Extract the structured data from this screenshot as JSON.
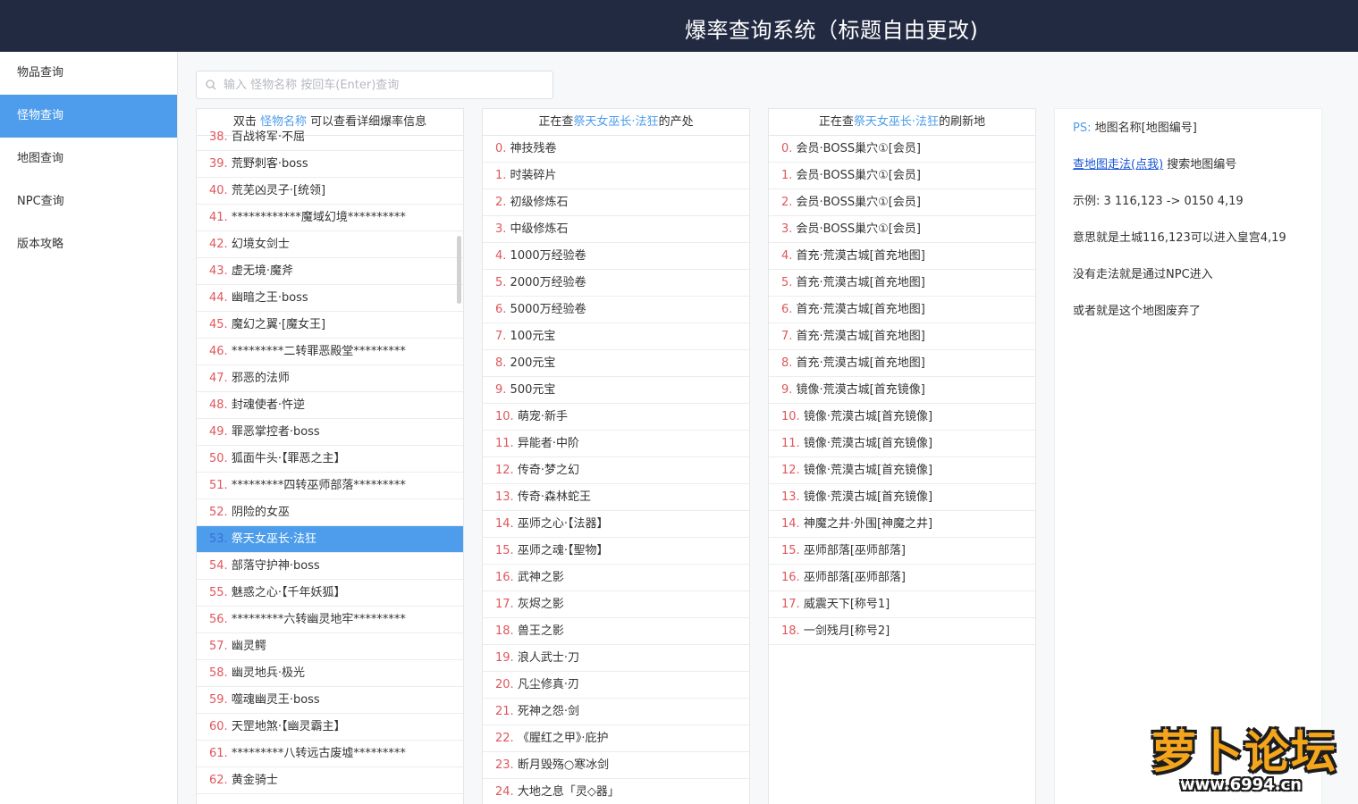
{
  "header": {
    "title": "爆率查询系统（标题自由更改)"
  },
  "sidebar": {
    "items": [
      {
        "label": "物品查询",
        "active": false
      },
      {
        "label": "怪物查询",
        "active": true
      },
      {
        "label": "地图查询",
        "active": false
      },
      {
        "label": "NPC查询",
        "active": false
      },
      {
        "label": "版本攻略",
        "active": false
      }
    ]
  },
  "search": {
    "placeholder": "输入 怪物名称 按回车(Enter)查询",
    "value": ""
  },
  "monster_list": {
    "head_prefix": "双击 ",
    "head_highlight": "怪物名称",
    "head_suffix": " 可以查看详细爆率信息",
    "selected_index": 15,
    "rows": [
      {
        "idx": "38",
        "name": "百战将军·不屈"
      },
      {
        "idx": "39",
        "name": "荒野刺客·boss"
      },
      {
        "idx": "40",
        "name": "荒芜凶灵子·[统领]"
      },
      {
        "idx": "41",
        "name": "************魔域幻境**********"
      },
      {
        "idx": "42",
        "name": "幻境女剑士"
      },
      {
        "idx": "43",
        "name": "虚无境·魔斧"
      },
      {
        "idx": "44",
        "name": "幽暗之王·boss"
      },
      {
        "idx": "45",
        "name": "魔幻之翼·[魔女王]"
      },
      {
        "idx": "46",
        "name": "*********二转罪恶殿堂*********"
      },
      {
        "idx": "47",
        "name": "邪恶的法师"
      },
      {
        "idx": "48",
        "name": "封魂使者·忤逆"
      },
      {
        "idx": "49",
        "name": "罪恶掌控者·boss"
      },
      {
        "idx": "50",
        "name": "狐面牛头·【罪恶之主】"
      },
      {
        "idx": "51",
        "name": "*********四转巫师部落*********"
      },
      {
        "idx": "52",
        "name": "阴险的女巫"
      },
      {
        "idx": "53",
        "name": "祭天女巫长·法狂"
      },
      {
        "idx": "54",
        "name": "部落守护神·boss"
      },
      {
        "idx": "55",
        "name": "魅惑之心·【千年妖狐】"
      },
      {
        "idx": "56",
        "name": "*********六转幽灵地牢*********"
      },
      {
        "idx": "57",
        "name": "幽灵鳄"
      },
      {
        "idx": "58",
        "name": "幽灵地兵·极光"
      },
      {
        "idx": "59",
        "name": "噬魂幽灵王·boss"
      },
      {
        "idx": "60",
        "name": "天罡地煞·【幽灵霸主】"
      },
      {
        "idx": "61",
        "name": "*********八转远古废墟*********"
      },
      {
        "idx": "62",
        "name": "黄金骑士"
      }
    ]
  },
  "drops": {
    "head_prefix": "正在查",
    "head_highlight": "祭天女巫长·法狂",
    "head_suffix": "的产处",
    "rows": [
      {
        "idx": "0",
        "name": "神技残卷"
      },
      {
        "idx": "1",
        "name": "时装碎片"
      },
      {
        "idx": "2",
        "name": "初级修炼石"
      },
      {
        "idx": "3",
        "name": "中级修炼石"
      },
      {
        "idx": "4",
        "name": "1000万经验卷"
      },
      {
        "idx": "5",
        "name": "2000万经验卷"
      },
      {
        "idx": "6",
        "name": "5000万经验卷"
      },
      {
        "idx": "7",
        "name": "100元宝"
      },
      {
        "idx": "8",
        "name": "200元宝"
      },
      {
        "idx": "9",
        "name": "500元宝"
      },
      {
        "idx": "10",
        "name": "萌宠·新手"
      },
      {
        "idx": "11",
        "name": "异能者·中阶"
      },
      {
        "idx": "12",
        "name": "传奇·梦之幻"
      },
      {
        "idx": "13",
        "name": "传奇·森林蛇王"
      },
      {
        "idx": "14",
        "name": "巫师之心·【法器】"
      },
      {
        "idx": "15",
        "name": "巫师之魂·【聖物】"
      },
      {
        "idx": "16",
        "name": "武神之影"
      },
      {
        "idx": "17",
        "name": "灰烬之影"
      },
      {
        "idx": "18",
        "name": "兽王之影"
      },
      {
        "idx": "19",
        "name": "浪人武士·刀"
      },
      {
        "idx": "20",
        "name": "凡尘修真·刃"
      },
      {
        "idx": "21",
        "name": "死神之怨·剑"
      },
      {
        "idx": "22",
        "name": "《腥红之甲》·庇护"
      },
      {
        "idx": "23",
        "name": "断月毁殇○寒冰剑"
      },
      {
        "idx": "24",
        "name": "大地之息「灵◇器」"
      }
    ]
  },
  "spawns": {
    "head_prefix": "正在查",
    "head_highlight": "祭天女巫长·法狂",
    "head_suffix": "的刷新地",
    "rows": [
      {
        "idx": "0",
        "name": "会员·BOSS巢穴①[会员]"
      },
      {
        "idx": "1",
        "name": "会员·BOSS巢穴①[会员]"
      },
      {
        "idx": "2",
        "name": "会员·BOSS巢穴①[会员]"
      },
      {
        "idx": "3",
        "name": "会员·BOSS巢穴①[会员]"
      },
      {
        "idx": "4",
        "name": "首充·荒漠古城[首充地图]"
      },
      {
        "idx": "5",
        "name": "首充·荒漠古城[首充地图]"
      },
      {
        "idx": "6",
        "name": "首充·荒漠古城[首充地图]"
      },
      {
        "idx": "7",
        "name": "首充·荒漠古城[首充地图]"
      },
      {
        "idx": "8",
        "name": "首充·荒漠古城[首充地图]"
      },
      {
        "idx": "9",
        "name": "镜像·荒漠古城[首充镜像]"
      },
      {
        "idx": "10",
        "name": "镜像·荒漠古城[首充镜像]"
      },
      {
        "idx": "11",
        "name": "镜像·荒漠古城[首充镜像]"
      },
      {
        "idx": "12",
        "name": "镜像·荒漠古城[首充镜像]"
      },
      {
        "idx": "13",
        "name": "镜像·荒漠古城[首充镜像]"
      },
      {
        "idx": "14",
        "name": "神魔之井·外围[神魔之井]"
      },
      {
        "idx": "15",
        "name": "巫师部落[巫师部落]"
      },
      {
        "idx": "16",
        "name": "巫师部落[巫师部落]"
      },
      {
        "idx": "17",
        "name": "威震天下[称号1]"
      },
      {
        "idx": "18",
        "name": "一剑残月[称号2]"
      }
    ]
  },
  "notes": {
    "ps_label": "PS:",
    "ps_text": " 地图名称[地图编号]",
    "link_text": "查地图走法(点我)",
    "link_suffix": " 搜索地图编号",
    "example": "示例: 3 116,123 -> 0150 4,19",
    "meaning": "意思就是土城116,123可以进入皇宫4,19",
    "no_route": "没有走法就是通过NPC进入",
    "abandoned": "或者就是这个地图废弃了"
  },
  "watermark": {
    "text": "萝卜论坛",
    "url": "www.6994.cn"
  },
  "colors": {
    "header_bg": "#222a41",
    "accent": "#4d9dec",
    "index": "#e0565b"
  }
}
